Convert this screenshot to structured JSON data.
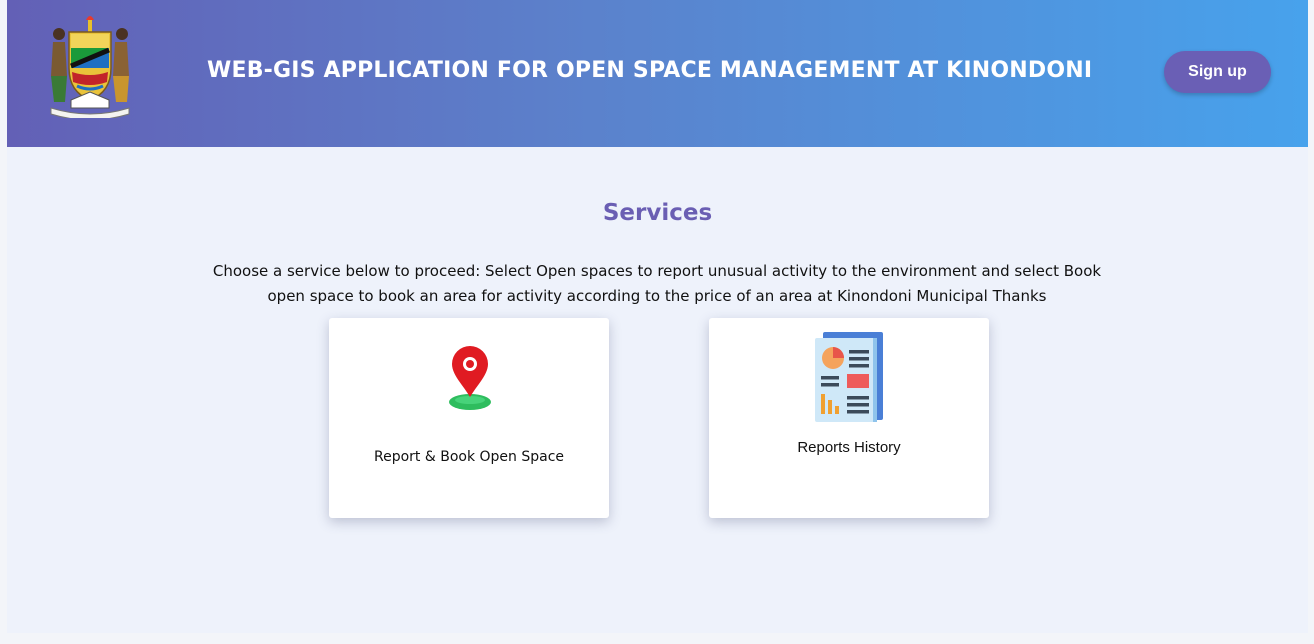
{
  "header": {
    "title": "WEB-GIS APPLICATION FOR OPEN SPACE MANAGEMENT AT KINONDONI",
    "signup_label": "Sign up",
    "emblem_icon": "coat-of-arms-emblem"
  },
  "main": {
    "services_title": "Services",
    "intro_text": "Choose a service below to proceed: Select Open spaces to report unusual activity to the environment and select Book open space to book an area for activity according to the price of an area at Kinondoni Municipal Thanks",
    "cards": [
      {
        "label": "Report & Book Open Space",
        "icon": "location-pin-icon"
      },
      {
        "label": "Reports History",
        "icon": "report-document-icon"
      }
    ]
  },
  "colors": {
    "header_gradient_start": "#6360b6",
    "header_gradient_end": "#47a2ec",
    "accent": "#6a5eb3",
    "page_background": "#eef2fb"
  }
}
